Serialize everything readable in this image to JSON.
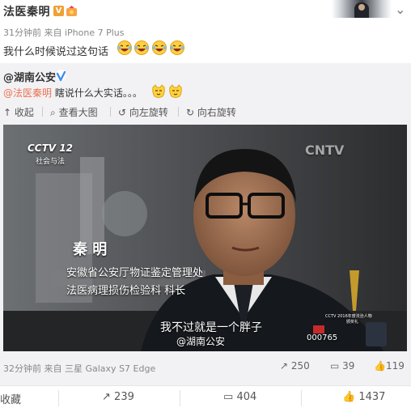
{
  "header": {
    "username": "法医秦明",
    "verified_badge": "V",
    "level_icon": "level-badge-icon",
    "options_icon": "chevron-down-icon",
    "meta": "31分钟前 来自 iPhone 7 Plus",
    "text": "我什么时候说过这句话",
    "emojis": [
      "laugh-cry-emoji",
      "laugh-cry-emoji",
      "laugh-cry-emoji",
      "laugh-cry-emoji"
    ]
  },
  "repost": {
    "author": "@湖南公安",
    "line_mention": "@法医秦明",
    "line_text": " 瞎说什么大实话。。。",
    "line_emojis": [
      "smug-cat-emoji",
      "smug-cat-emoji"
    ],
    "toolbar": {
      "collapse": "收起",
      "view_large": "查看大图",
      "rotate_left": "向左旋转",
      "rotate_right": "向右旋转"
    },
    "video": {
      "channel_logo": "CCTV 12",
      "channel_sub": "社会与法",
      "watermark": "CNTV",
      "name": "秦  明",
      "title_line1": "安徽省公安厅物证鉴定管理处",
      "title_line2": "法医病理损伤检验科  科长",
      "subtitle": "我不过就是一个胖子",
      "subtitle_handle": "@湖南公安",
      "badge_number": "000765",
      "trophy_text": "CCTV 2016年度法治人物",
      "trophy_sub": "颁奖礼"
    },
    "footer_meta": "32分钟前 来自 三星 Galaxy S7 Edge",
    "stats": {
      "share": "250",
      "comment": "39",
      "like": "119"
    }
  },
  "actions": {
    "favorite": "收藏",
    "share": "239",
    "comment": "404",
    "like": "1437"
  },
  "colors": {
    "accent_orange": "#eb7350",
    "verified_orange": "#f0a033",
    "verified_blue": "#3d8ff0",
    "repost_bg": "#f2f2f5"
  }
}
